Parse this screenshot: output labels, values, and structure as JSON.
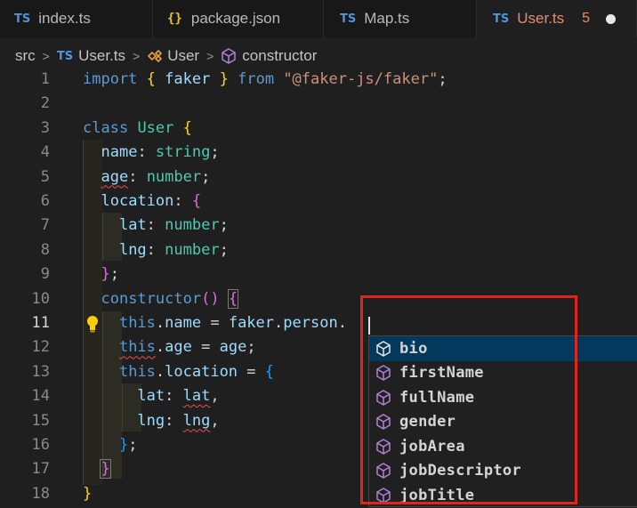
{
  "tabs": [
    {
      "icon": "TS",
      "label": "index.ts"
    },
    {
      "icon": "{}",
      "label": "package.json"
    },
    {
      "icon": "TS",
      "label": "Map.ts"
    },
    {
      "icon": "TS",
      "label": "User.ts",
      "badge": "5"
    }
  ],
  "breadcrumb": {
    "folder": "src",
    "file_icon": "TS",
    "file": "User.ts",
    "class": "User",
    "member": "constructor"
  },
  "editor": {
    "current_line": 11,
    "lines": [
      {
        "n": "1"
      },
      {
        "n": "2"
      },
      {
        "n": "3"
      },
      {
        "n": "4"
      },
      {
        "n": "5"
      },
      {
        "n": "6"
      },
      {
        "n": "7"
      },
      {
        "n": "8"
      },
      {
        "n": "9"
      },
      {
        "n": "10"
      },
      {
        "n": "11"
      },
      {
        "n": "12"
      },
      {
        "n": "13"
      },
      {
        "n": "14"
      },
      {
        "n": "15"
      },
      {
        "n": "16"
      },
      {
        "n": "17"
      },
      {
        "n": "18"
      }
    ]
  },
  "suggestions": {
    "selected": "bio",
    "items": [
      "bio",
      "firstName",
      "fullName",
      "gender",
      "jobArea",
      "jobDescriptor",
      "jobTitle"
    ]
  },
  "colors": {
    "highlight_box": "#e0241e",
    "selected_row": "#04395e",
    "active_tab_text": "#e98b6d"
  }
}
